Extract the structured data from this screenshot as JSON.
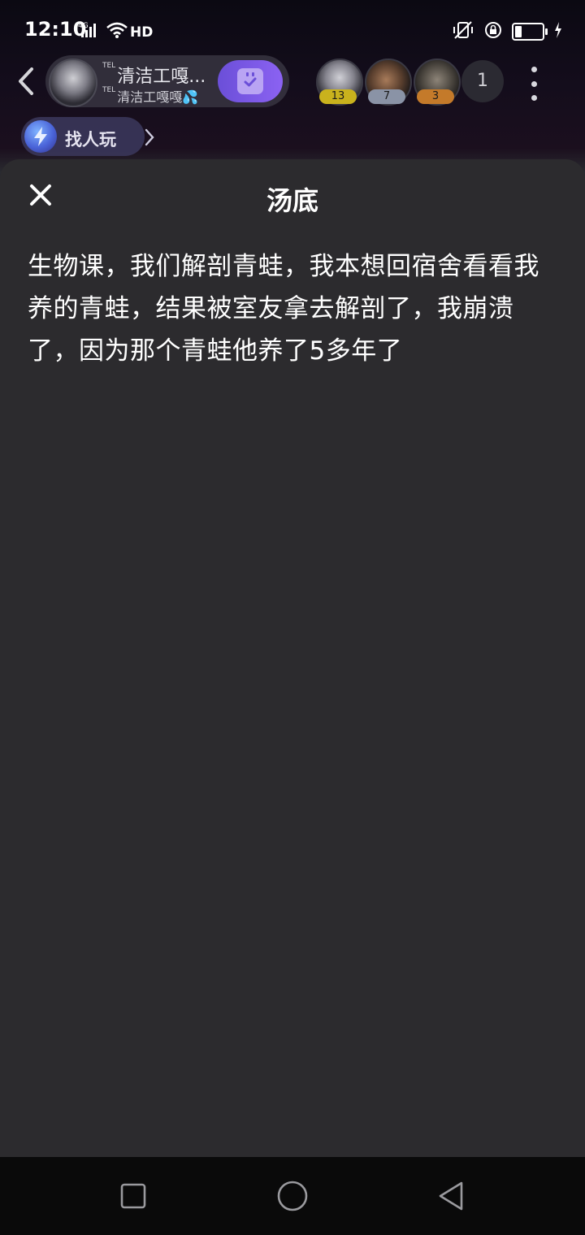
{
  "status_bar": {
    "time": "12:10",
    "network": "4G",
    "hd_label": "HD",
    "battery_level": 0.25
  },
  "room": {
    "tel_tag": "TEL",
    "title": "清洁工嘎...",
    "sub_tel_tag": "TEL",
    "subtitle": "清洁工嘎嘎",
    "subtitle_emoji": "💦",
    "members": [
      {
        "badge": "13",
        "badge_color": "#c9b21d"
      },
      {
        "badge": "7",
        "badge_color": "#8a93a6"
      },
      {
        "badge": "3",
        "badge_color": "#c47a2a"
      }
    ],
    "member_count": "1"
  },
  "find_play": {
    "label": "找人玩"
  },
  "sheet": {
    "title": "汤底",
    "body": "生物课，我们解剖青蛙，我本想回宿舍看看我养的青蛙，结果被室友拿去解剖了，我崩溃了，因为那个青蛙他养了5多年了"
  },
  "colors": {
    "accent": "#7b5ae6",
    "sheet_bg": "#2c2b2e"
  }
}
